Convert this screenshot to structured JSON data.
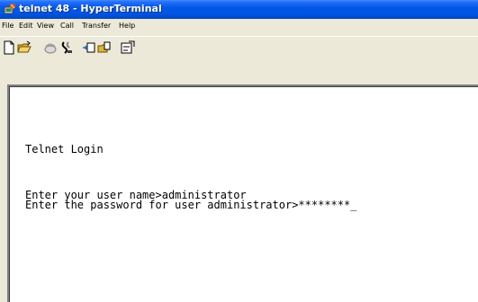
{
  "window": {
    "title": "telnet 48 - HyperTerminal"
  },
  "menu": [
    "File",
    "Edit",
    "View",
    "Call",
    "Transfer",
    "Help"
  ],
  "toolbar": {
    "buttons": [
      "new-document-icon",
      "open-folder-icon",
      "call-icon",
      "disconnect-icon",
      "send-icon",
      "receive-icon",
      "properties-icon"
    ]
  },
  "terminal": {
    "lines": [
      "Telnet Login",
      "Enter your user name>administrator",
      "Enter the password for user administrator>********_"
    ]
  },
  "colors": {
    "titlebar": "#0055e5",
    "chrome": "#ece9d8",
    "terminal_bg": "#ffffff"
  }
}
